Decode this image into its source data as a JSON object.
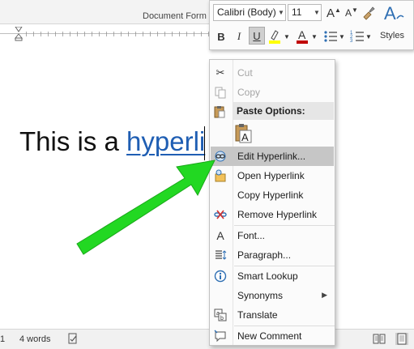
{
  "ribbon": {
    "group_label": "Document Form"
  },
  "document": {
    "text_before": "This is a ",
    "link_text": "hyperli"
  },
  "statusbar": {
    "page": "1",
    "words": "4 words"
  },
  "mini_toolbar": {
    "font_name": "Calibri (Body)",
    "font_size": "11",
    "bold": "B",
    "italic": "I",
    "underline": "U",
    "styles_label": "Styles"
  },
  "context_menu": {
    "cut": "Cut",
    "copy": "Copy",
    "paste_options": "Paste Options:",
    "edit_hyperlink": "Edit Hyperlink...",
    "open_hyperlink": "Open Hyperlink",
    "copy_hyperlink": "Copy Hyperlink",
    "remove_hyperlink": "Remove Hyperlink",
    "font": "Font...",
    "paragraph": "Paragraph...",
    "smart_lookup": "Smart Lookup",
    "synonyms": "Synonyms",
    "translate": "Translate",
    "new_comment": "New Comment"
  },
  "colors": {
    "hyperlink": "#1f5eb3",
    "arrow": "#22d822",
    "highlight": "#ffff00",
    "font_color": "#c00000"
  }
}
